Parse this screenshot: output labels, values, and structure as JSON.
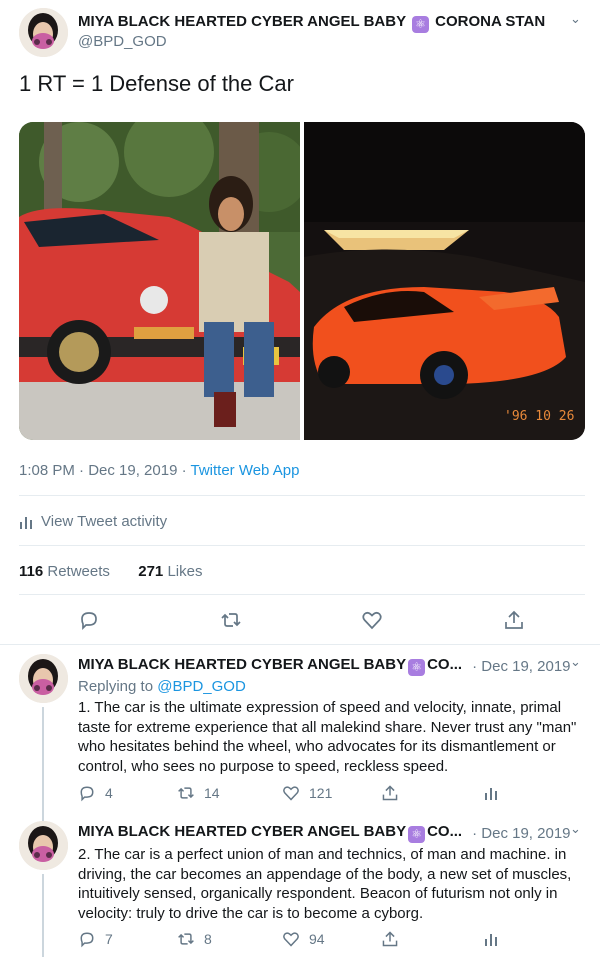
{
  "main_tweet": {
    "author_name_a": "MIYA BLACK HEARTED CYBER ANGEL BABY",
    "author_name_b": "CORONA STAN",
    "symbol_icon": "atom-symbol",
    "handle": "@BPD_GOD",
    "text": "1 RT = 1 Defense of the Car",
    "timestamp": "1:08 PM · Dec 19, 2019 · ",
    "source": "Twitter Web App",
    "activity_label": "View Tweet activity",
    "retweets_count": "116",
    "retweets_label": "Retweets",
    "likes_count": "271",
    "likes_label": "Likes",
    "photo_stamp": "'96 10 26"
  },
  "replies": [
    {
      "author_name": "MIYA BLACK HEARTED CYBER ANGEL BABY",
      "author_suffix": "CO...",
      "date": "· Dec 19, 2019",
      "replying_prefix": "Replying to ",
      "replying_handle": "@BPD_GOD",
      "text": "1. The car is the ultimate expression of speed and velocity, innate, primal taste for extreme experience that all malekind share. Never trust any \"man\" who hesitates behind the wheel, who advocates for its dismantlement or control, who sees no purpose to speed, reckless speed.",
      "replies": "4",
      "retweets": "14",
      "likes": "121"
    },
    {
      "author_name": "MIYA BLACK HEARTED CYBER ANGEL BABY",
      "author_suffix": "CO...",
      "date": "· Dec 19, 2019",
      "text": "2. The car is a perfect union of man and technics, of man and machine. in driving, the car becomes an appendage of the body, a new set of muscles, intuitively sensed, organically respondent. Beacon of futurism not only in velocity: truly to drive the car is to become a cyborg.",
      "replies": "7",
      "retweets": "8",
      "likes": "94"
    }
  ],
  "colors": {
    "accent": "#1b95e0",
    "muted": "#657786",
    "divider": "#e6ecf0",
    "symbol": "#a87de0"
  }
}
